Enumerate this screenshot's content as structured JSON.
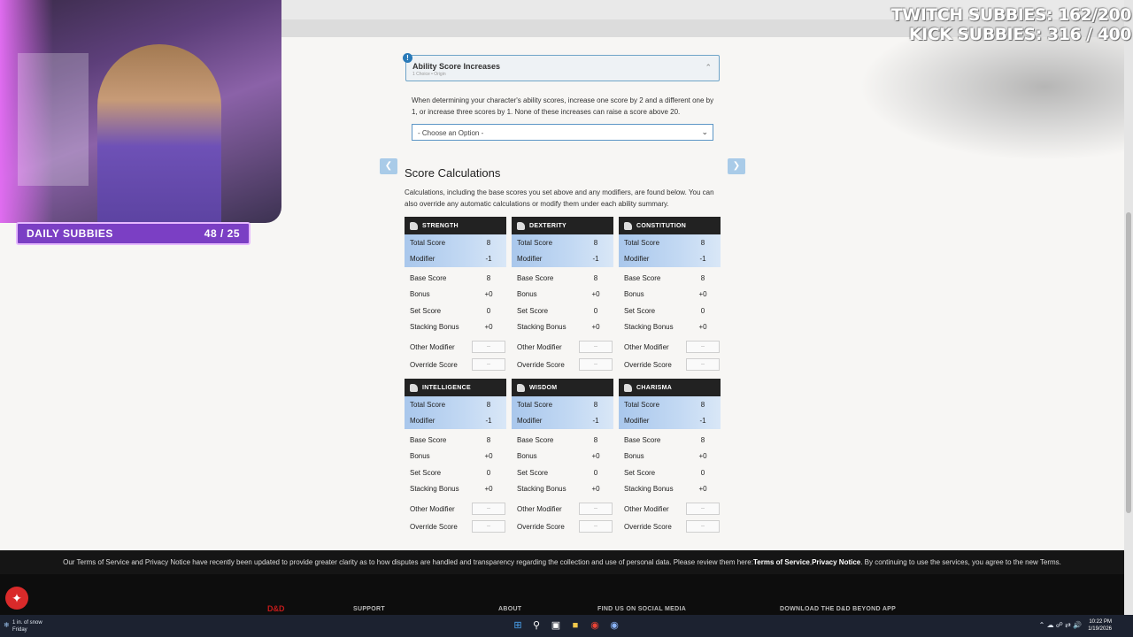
{
  "overlay": {
    "daily_subbies_label": "DAILY SUBBIES",
    "daily_subbies_value": "48 / 25",
    "twitch_subbies": "TWITCH SUBBIES: 162/200",
    "kick_subbies": "KICK SUBBIES: 316 / 400"
  },
  "asi": {
    "title": "Ability Score Increases",
    "subtitle": "1 Choice • Origin",
    "description": "When determining your character's ability scores, increase one score by 2 and a different one by 1, or increase three scores by 1. None of these increases can raise a score above 20.",
    "select_value": "- Choose an Option -"
  },
  "score_calc": {
    "title": "Score Calculations",
    "description": "Calculations, including the base scores you set above and any modifiers, are found below. You can also override any automatic calculations or modify them under each ability summary."
  },
  "row_labels": {
    "total": "Total Score",
    "modifier": "Modifier",
    "base": "Base Score",
    "bonus": "Bonus",
    "set": "Set Score",
    "stacking": "Stacking Bonus",
    "other": "Other Modifier",
    "override": "Override Score"
  },
  "abilities": [
    {
      "name": "STRENGTH",
      "icon": "strength-icon",
      "total": "8",
      "modifier": "-1",
      "base": "8",
      "bonus": "+0",
      "set": "0",
      "stacking": "+0",
      "other": "--",
      "override": "--"
    },
    {
      "name": "DEXTERITY",
      "icon": "dexterity-icon",
      "total": "8",
      "modifier": "-1",
      "base": "8",
      "bonus": "+0",
      "set": "0",
      "stacking": "+0",
      "other": "--",
      "override": "--"
    },
    {
      "name": "CONSTITUTION",
      "icon": "constitution-icon",
      "total": "8",
      "modifier": "-1",
      "base": "8",
      "bonus": "+0",
      "set": "0",
      "stacking": "+0",
      "other": "--",
      "override": "--"
    },
    {
      "name": "INTELLIGENCE",
      "icon": "intelligence-icon",
      "total": "8",
      "modifier": "-1",
      "base": "8",
      "bonus": "+0",
      "set": "0",
      "stacking": "+0",
      "other": "--",
      "override": "--"
    },
    {
      "name": "WISDOM",
      "icon": "wisdom-icon",
      "total": "8",
      "modifier": "-1",
      "base": "8",
      "bonus": "+0",
      "set": "0",
      "stacking": "+0",
      "other": "--",
      "override": "--"
    },
    {
      "name": "CHARISMA",
      "icon": "charisma-icon",
      "total": "8",
      "modifier": "-1",
      "base": "8",
      "bonus": "+0",
      "set": "0",
      "stacking": "+0",
      "other": "--",
      "override": "--"
    }
  ],
  "footer": {
    "tos_text": "Our Terms of Service and Privacy Notice have recently been updated to provide greater clarity as to how disputes are handled and transparency regarding the collection and use of personal data. Please review them here: ",
    "tos_link1": "Terms of Service",
    "tos_sep": ", ",
    "tos_link2": "Privacy Notice",
    "tos_tail": ". By continuing to use the services, you agree to the new Terms.",
    "logo_text": "D&D",
    "support": "SUPPORT",
    "about": "ABOUT",
    "social": "FIND US ON SOCIAL MEDIA",
    "app": "DOWNLOAD THE D&D BEYOND APP"
  },
  "taskbar": {
    "weather_line1": "1 in. of snow",
    "weather_line2": "Friday",
    "time": "10:22 PM",
    "date": "1/19/2026"
  },
  "colors": {
    "accent_blue": "#5d96c6",
    "highlight_row": "#a9c7ec",
    "subbies_purple": "#7b3fc4",
    "ddb_red": "#d92a2a"
  }
}
